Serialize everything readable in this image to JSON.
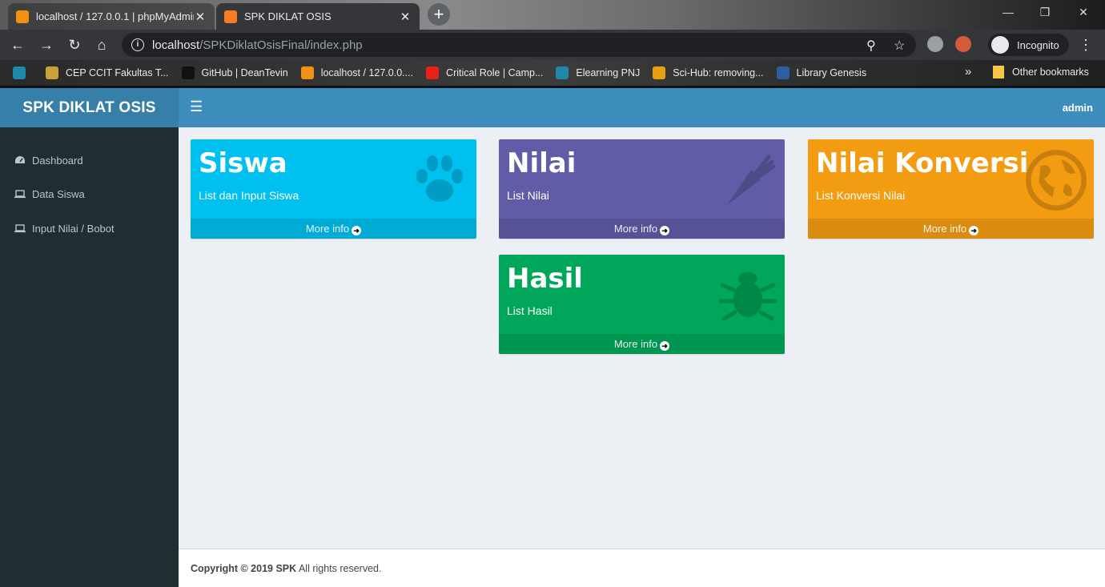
{
  "browser": {
    "tabs": [
      {
        "title": "localhost / 127.0.0.1 | phpMyAdmin",
        "active": false
      },
      {
        "title": "SPK DIKLAT OSIS",
        "active": true
      }
    ],
    "url_host": "localhost",
    "url_path": "/SPKDiklatOsisFinal/index.php",
    "profile_label": "Incognito",
    "bookmarks": [
      {
        "label": "",
        "color": "#1e88a8"
      },
      {
        "label": "CEP CCIT Fakultas T...",
        "color": "#c8a13a"
      },
      {
        "label": "GitHub | DeanTevin",
        "color": "#111111"
      },
      {
        "label": "localhost / 127.0.0....",
        "color": "#f29111"
      },
      {
        "label": "Critical Role | Camp...",
        "color": "#e62117"
      },
      {
        "label": "Elearning PNJ",
        "color": "#1e88a8"
      },
      {
        "label": "Sci-Hub: removing...",
        "color": "#e8a010"
      },
      {
        "label": "Library Genesis",
        "color": "#2b5f9e"
      }
    ],
    "bookmarks_more": "»",
    "other_bookmarks": "Other bookmarks"
  },
  "app": {
    "brand": "SPK DIKLAT OSIS",
    "user": "admin",
    "sidebar": [
      {
        "label": "Dashboard",
        "icon": "dashboard-icon"
      },
      {
        "label": "Data Siswa",
        "icon": "laptop-icon"
      },
      {
        "label": "Input Nilai / Bobot",
        "icon": "laptop-icon"
      }
    ],
    "boxes": [
      {
        "title": "Siswa",
        "subtitle": "List dan Input Siswa",
        "footer": "More info",
        "color": "#00c0ef",
        "icon": "paw-icon"
      },
      {
        "title": "Nilai",
        "subtitle": "List Nilai",
        "footer": "More info",
        "color": "#605ca8",
        "icon": "carrot-icon"
      },
      {
        "title": "Nilai Konversi",
        "subtitle": "List Konversi Nilai",
        "footer": "More info",
        "color": "#f39c12",
        "icon": "globe-icon"
      },
      {
        "title": "Hasil",
        "subtitle": "List Hasil",
        "footer": "More info",
        "color": "#00a65a",
        "icon": "bug-icon"
      }
    ],
    "footer": {
      "copyright": "Copyright © 2019 SPK",
      "rights": " All rights reserved."
    }
  }
}
